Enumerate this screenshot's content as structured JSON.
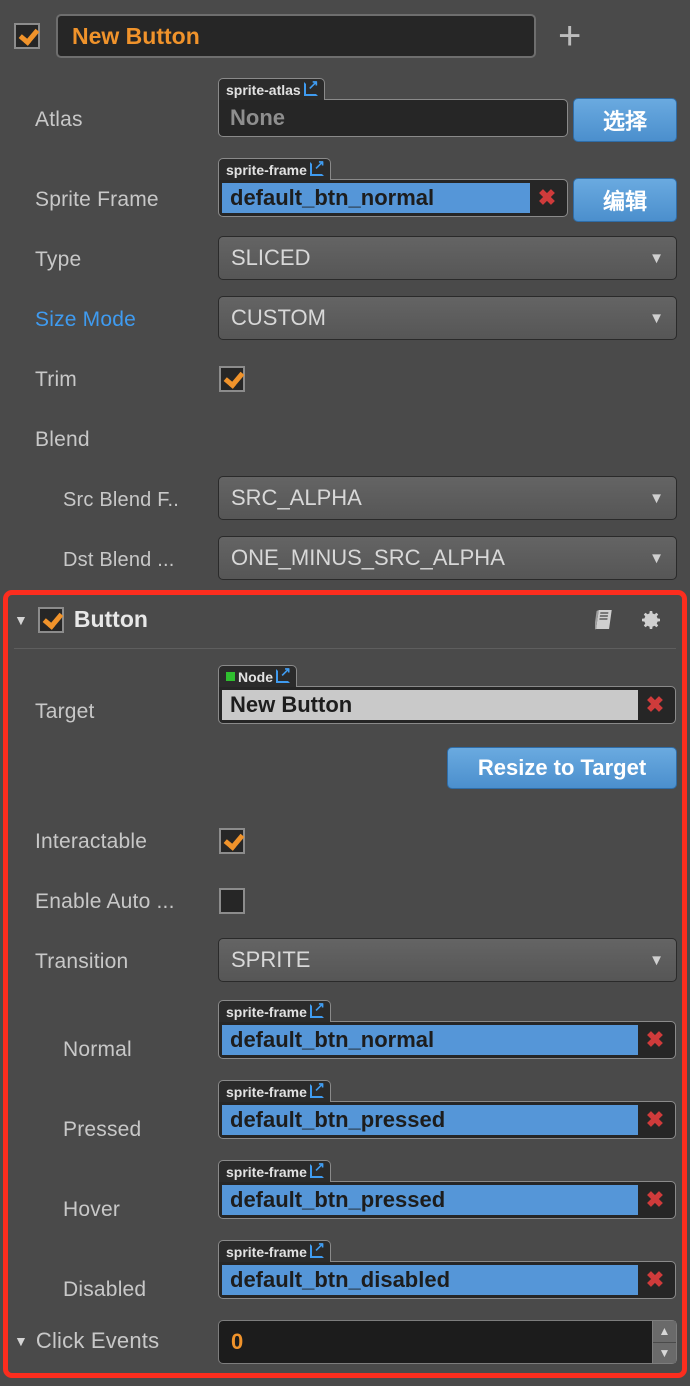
{
  "node": {
    "enabled_checkbox": true,
    "name": "New Button",
    "add_component_label": "+"
  },
  "sprite_component": {
    "rows": {
      "atlas": {
        "label": "Atlas",
        "asset_type": "sprite-atlas",
        "value": "None",
        "button": "选择"
      },
      "sprite_frame": {
        "label": "Sprite Frame",
        "asset_type": "sprite-frame",
        "value": "default_btn_normal",
        "button": "编辑"
      },
      "type": {
        "label": "Type",
        "value": "SLICED"
      },
      "size_mode": {
        "label": "Size Mode",
        "value": "CUSTOM"
      },
      "trim": {
        "label": "Trim",
        "checked": true
      },
      "blend": {
        "label": "Blend"
      },
      "src_blend": {
        "label": "Src Blend F..",
        "value": "SRC_ALPHA"
      },
      "dst_blend": {
        "label": "Dst Blend ...",
        "value": "ONE_MINUS_SRC_ALPHA"
      }
    }
  },
  "button_component": {
    "title": "Button",
    "enabled_checkbox": true,
    "collapse_arrow": "▼",
    "icons": {
      "help": "book-icon",
      "settings": "gear-icon"
    },
    "target": {
      "label": "Target",
      "asset_type": "Node",
      "value": "New Button"
    },
    "resize_button": "Resize to Target",
    "interactable": {
      "label": "Interactable",
      "checked": true
    },
    "enable_auto": {
      "label": "Enable Auto ...",
      "checked": false
    },
    "transition": {
      "label": "Transition",
      "value": "SPRITE"
    },
    "states": [
      {
        "label": "Normal",
        "asset_type": "sprite-frame",
        "value": "default_btn_normal"
      },
      {
        "label": "Pressed",
        "asset_type": "sprite-frame",
        "value": "default_btn_pressed"
      },
      {
        "label": "Hover",
        "asset_type": "sprite-frame",
        "value": "default_btn_pressed"
      },
      {
        "label": "Disabled",
        "asset_type": "sprite-frame",
        "value": "default_btn_disabled"
      }
    ],
    "click_events": {
      "label": "Click Events",
      "arrow": "▼",
      "value": "0"
    }
  },
  "colors": {
    "background": "#4a4a4a",
    "accent_orange": "#f0932b",
    "accent_blue": "#3f9bf0",
    "highlight_red": "#fc2d1e",
    "asset_selected": "#5596d8"
  }
}
